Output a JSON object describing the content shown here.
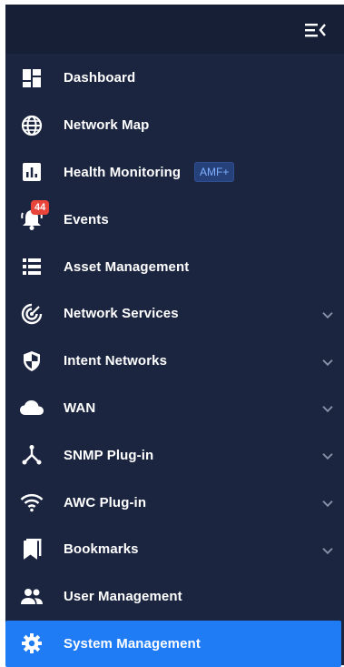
{
  "colors": {
    "sidebar_bg": "#1b2540",
    "topbar_bg": "#161f36",
    "active_bg": "#1f7cf5",
    "badge_red": "#e8443a",
    "amf_badge_bg": "#26407a",
    "amf_badge_text": "#7fb0ff"
  },
  "topbar": {
    "collapse_icon": "menu-collapse-icon"
  },
  "menu": {
    "items": [
      {
        "label": "Dashboard",
        "icon": "dashboard-icon"
      },
      {
        "label": "Network Map",
        "icon": "globe-icon"
      },
      {
        "label": "Health Monitoring",
        "icon": "bar-chart-icon",
        "tag": "AMF+"
      },
      {
        "label": "Events",
        "icon": "bell-icon",
        "count": "44"
      },
      {
        "label": "Asset Management",
        "icon": "list-icon"
      },
      {
        "label": "Network Services",
        "icon": "target-icon",
        "expandable": true
      },
      {
        "label": "Intent Networks",
        "icon": "shield-icon",
        "expandable": true
      },
      {
        "label": "WAN",
        "icon": "cloud-icon",
        "expandable": true
      },
      {
        "label": "SNMP Plug-in",
        "icon": "topology-icon",
        "expandable": true
      },
      {
        "label": "AWC Plug-in",
        "icon": "wifi-icon",
        "expandable": true
      },
      {
        "label": "Bookmarks",
        "icon": "bookmark-icon",
        "expandable": true
      },
      {
        "label": "User Management",
        "icon": "users-icon"
      },
      {
        "label": "System Management",
        "icon": "gear-icon",
        "active": true
      }
    ]
  }
}
